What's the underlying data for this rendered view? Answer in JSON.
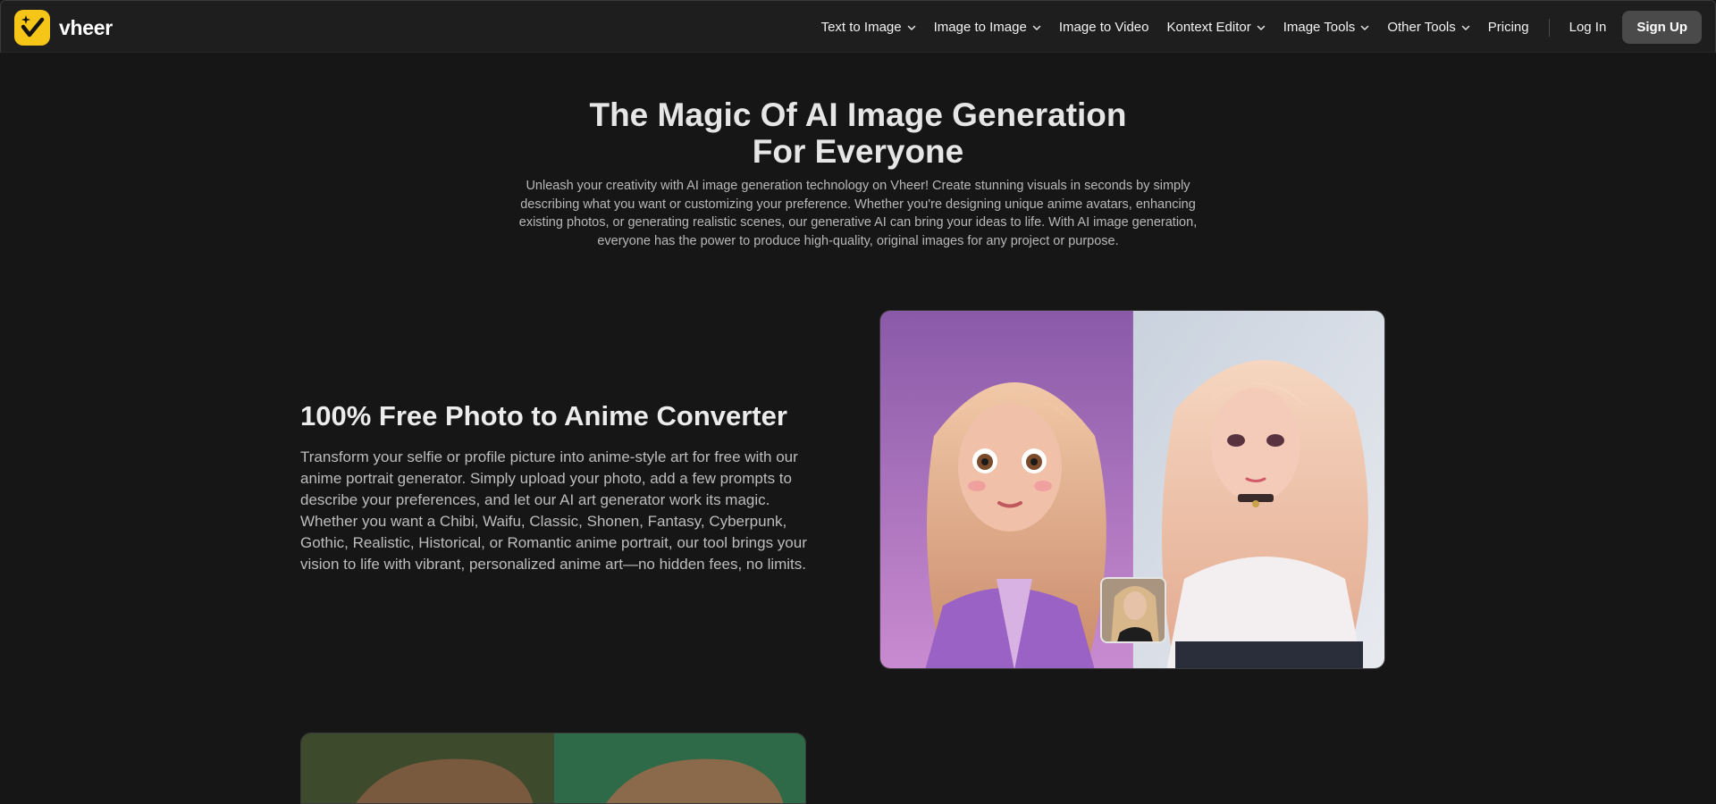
{
  "header": {
    "brand": "vheer",
    "logo_icon": "checkmark-sparkle-logo",
    "nav": [
      {
        "label": "Text to Image",
        "has_dropdown": true
      },
      {
        "label": "Image to Image",
        "has_dropdown": true
      },
      {
        "label": "Image to Video",
        "has_dropdown": false
      },
      {
        "label": "Kontext Editor",
        "has_dropdown": true
      },
      {
        "label": "Image Tools",
        "has_dropdown": true
      },
      {
        "label": "Other Tools",
        "has_dropdown": true
      },
      {
        "label": "Pricing",
        "has_dropdown": false
      }
    ],
    "login_label": "Log In",
    "signup_label": "Sign Up"
  },
  "hero": {
    "title_line1": "The Magic Of AI Image Generation",
    "title_line2": "For Everyone",
    "description": "Unleash your creativity with AI image generation technology on Vheer! Create stunning visuals in seconds by simply describing what you want or customizing your preference. Whether you're designing unique anime avatars, enhancing existing photos, or generating realistic scenes, our generative AI can bring your ideas to life. With AI image generation, everyone has the power to produce high-quality, original images for any project or purpose."
  },
  "feature": {
    "title": "100% Free Photo to Anime Converter",
    "description": "Transform your selfie or profile picture into anime-style art for free with our anime portrait generator. Simply upload your photo, add a few prompts to describe your preferences, and let our AI art generator work its magic. Whether you want a Chibi, Waifu, Classic, Shonen, Fantasy, Cyberpunk, Gothic, Realistic, Historical, or Romantic anime portrait, our tool brings your vision to life with vibrant, personalized anime art—no hidden fees, no limits."
  },
  "colors": {
    "background": "#161616",
    "header_bg": "#1e1e1e",
    "brand_yellow": "#f5c518",
    "signup_bg": "#4a4a4a"
  }
}
